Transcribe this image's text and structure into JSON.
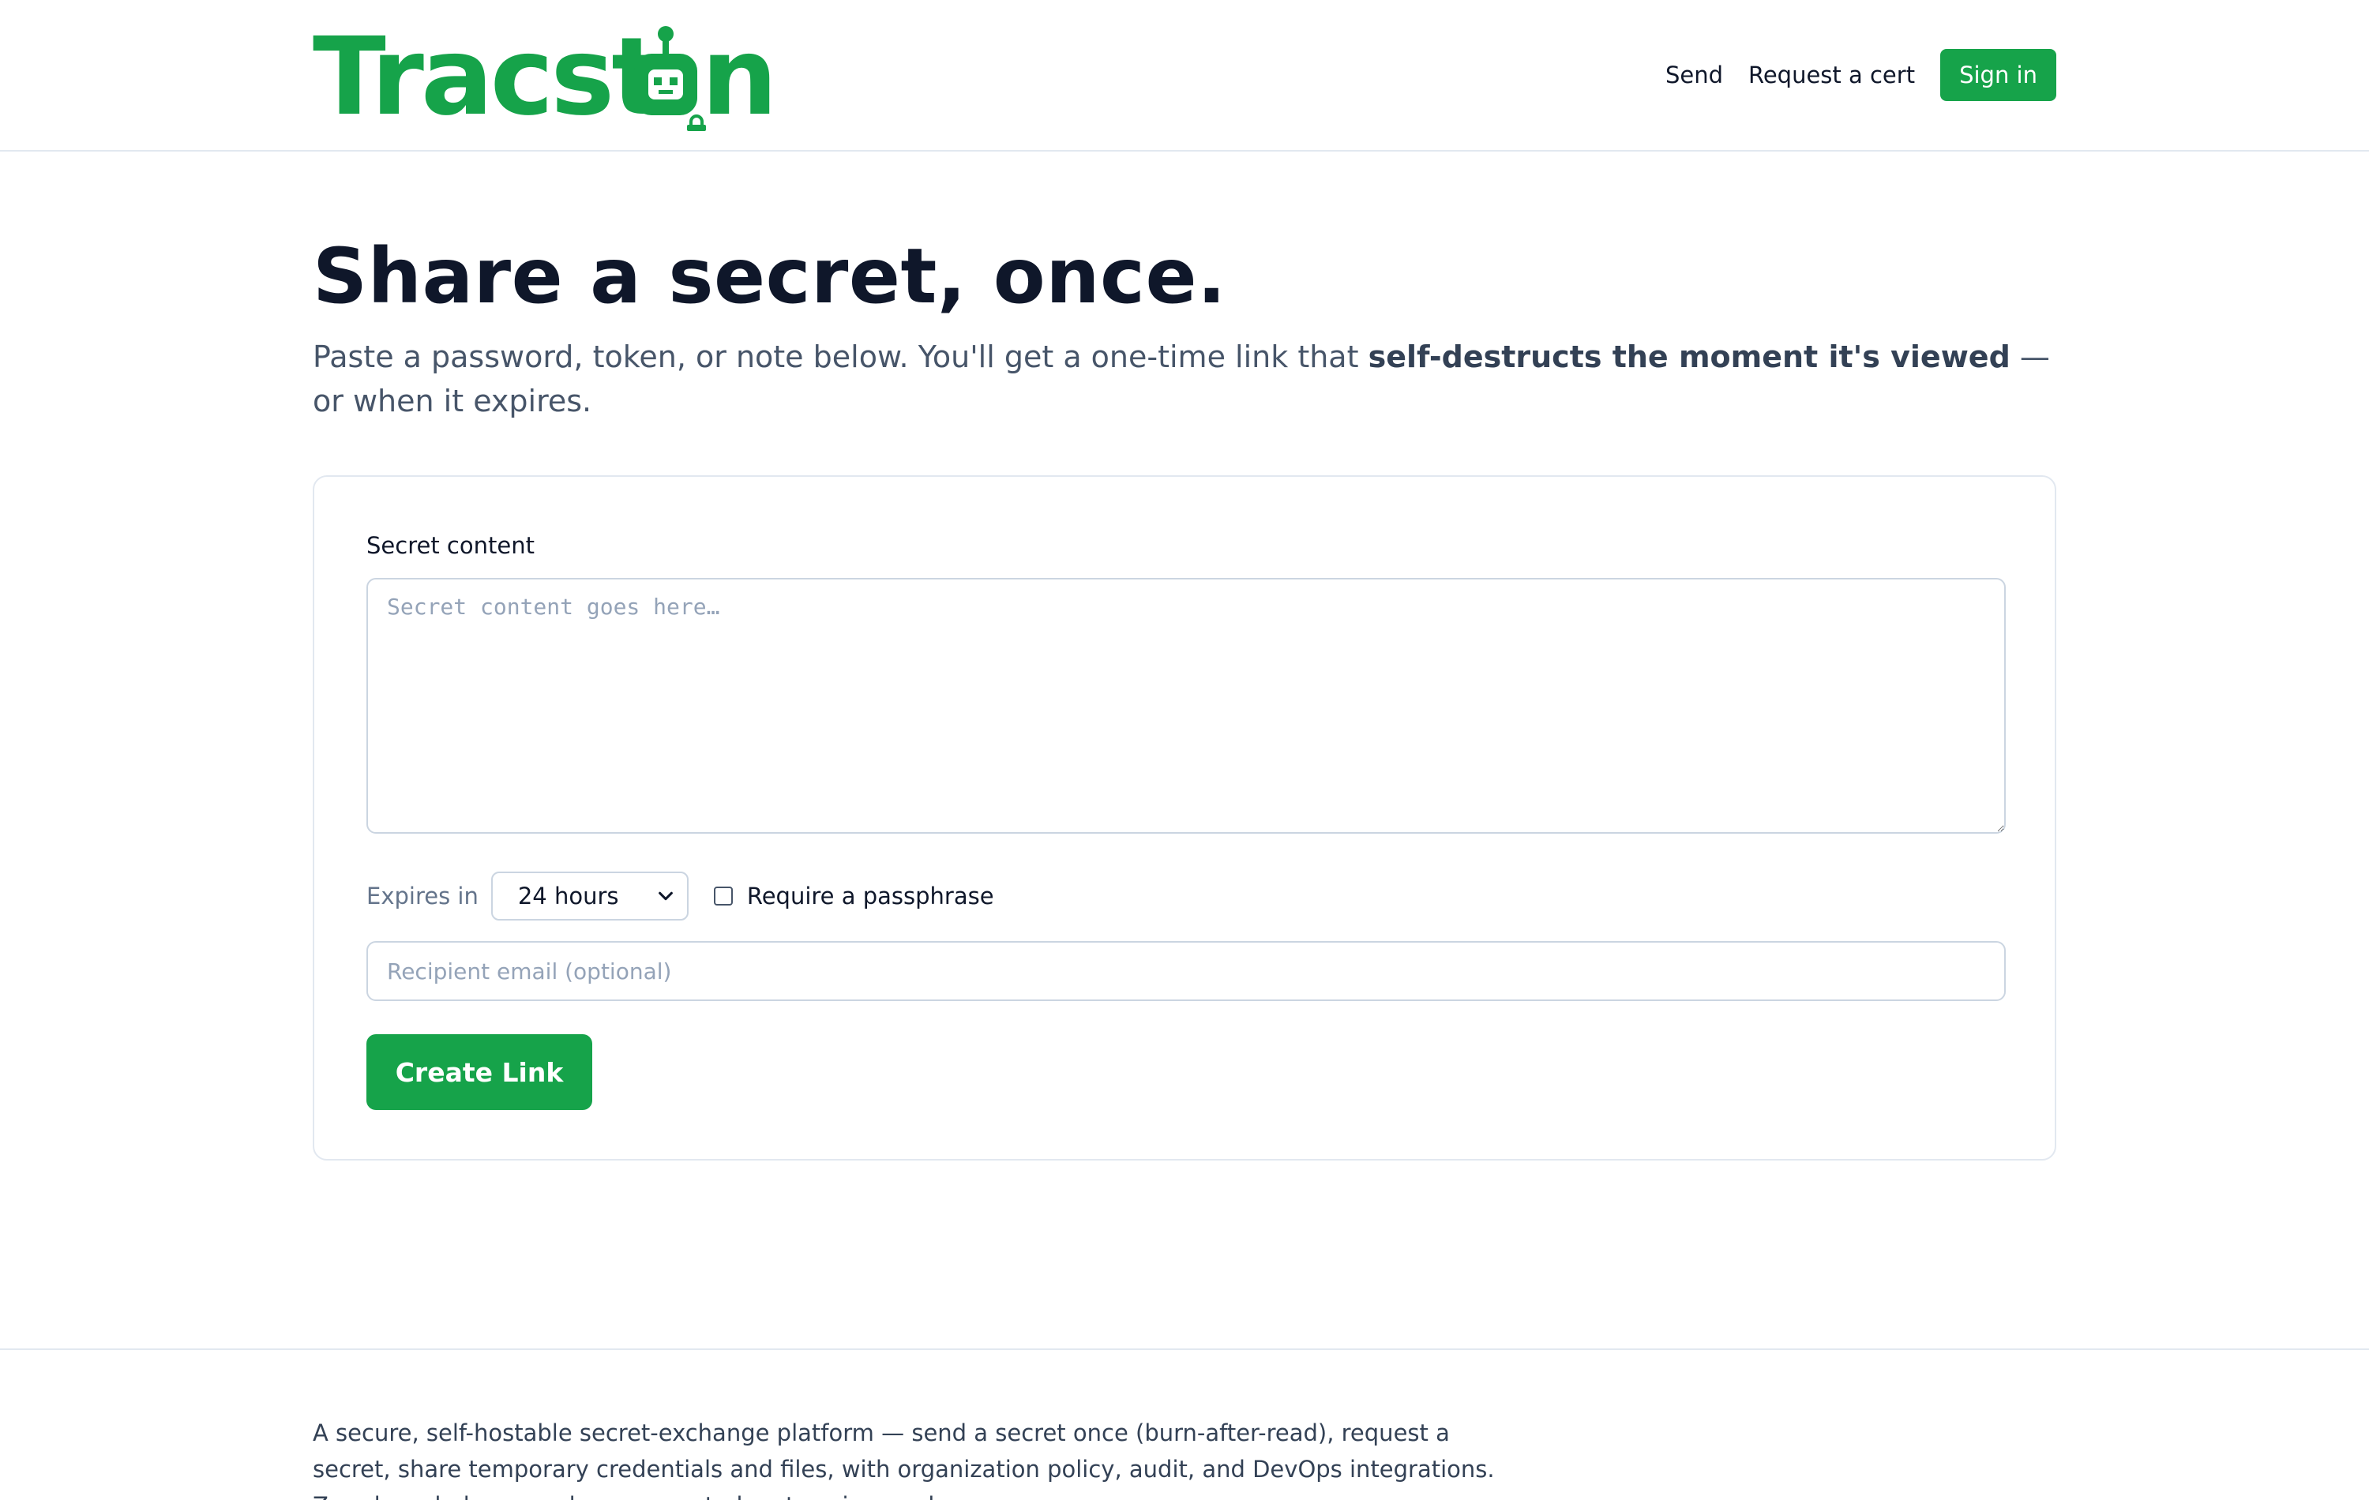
{
  "brand": {
    "name": "Tracston",
    "color": "#16a34a",
    "icon": "robot-lock-icon"
  },
  "nav": {
    "send_label": "Send",
    "request_label": "Request a cert",
    "signin_label": "Sign in"
  },
  "hero": {
    "title": "Share a secret, once.",
    "lead_before": "Paste a password, token, or note below. You'll get a one-time link that ",
    "lead_bold": "self-destructs the moment it's viewed",
    "lead_after": " — or when it expires."
  },
  "form": {
    "secret_label": "Secret content",
    "secret_value": "",
    "secret_placeholder": "Secret content goes here…",
    "expires_label": "Expires in",
    "expires_value": "24 hours",
    "require_passphrase_label": "Require a passphrase",
    "require_passphrase_checked": false,
    "email_value": "",
    "email_placeholder": "Recipient email (optional)",
    "submit_label": "Create Link"
  },
  "footer": {
    "description": "A secure, self-hostable secret-exchange platform — send a secret once (burn-after-read), request a secret, share temporary credentials and files, with organization policy, audit, and DevOps integrations. Zero-knowledge, envelope-encrypted, enterprise-ready."
  },
  "colors": {
    "accent": "#16a34a",
    "heading": "#0f172a",
    "muted": "#475569",
    "border": "#e2e8f0"
  }
}
